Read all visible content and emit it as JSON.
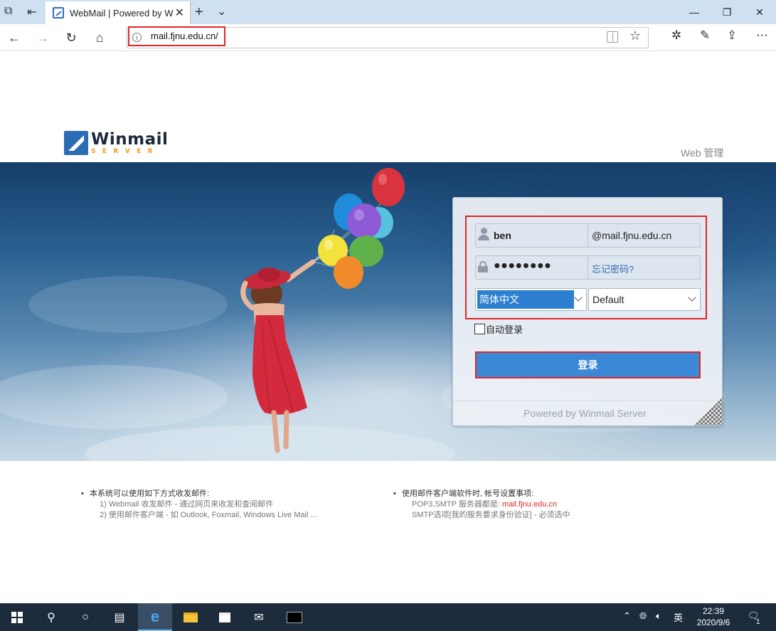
{
  "browser": {
    "tab_title": "WebMail | Powered by W",
    "url": "mail.fjnu.edu.cn/",
    "window_controls": [
      "minimize",
      "maximize",
      "close"
    ]
  },
  "page": {
    "logo": {
      "word": "Winmail",
      "sub": "SERVER"
    },
    "web_admin_label": "Web 管理",
    "login": {
      "username": "ben",
      "domain": "@mail.fjnu.edu.cn",
      "password_mask": "●●●●●●●●",
      "forgot_password": "忘记密码?",
      "language": "简体中文",
      "skin": "Default",
      "auto_login": "自动登录",
      "login_button": "登录",
      "powered_by": "Powered by Winmail Server"
    },
    "info_left": {
      "title": "本系统可以使用如下方式收发邮件:",
      "line1": "1) Webmail 收发邮件 - 通过网页来收发和查阅邮件",
      "line2": "2) 使用邮件客户端 - 如 Outlook, Foxmail, Windows Live Mail ..."
    },
    "info_right": {
      "title": "使用邮件客户端软件时, 帐号设置事项:",
      "line1_prefix": "POP3,SMTP 服务器都是: ",
      "line1_server": "mail.fjnu.edu.cn",
      "line2": "SMTP选项[我的服务要求身份验证] - 必须选中"
    }
  },
  "taskbar": {
    "ime": "英",
    "time": "22:39",
    "date": "2020/9/6",
    "notification_count": "1"
  }
}
